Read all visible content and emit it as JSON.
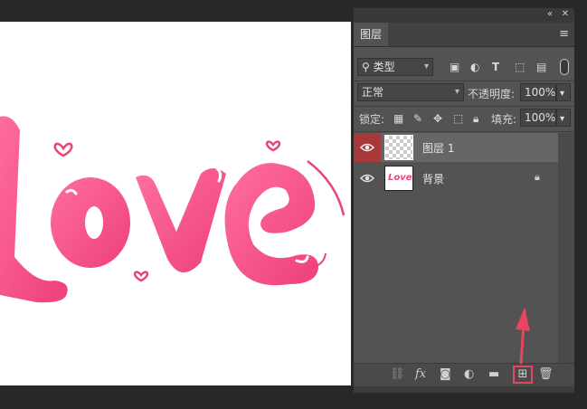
{
  "panel": {
    "tab_title": "图层",
    "filter": {
      "label": "类型"
    },
    "blend_mode": {
      "value": "正常"
    },
    "opacity": {
      "label": "不透明度:",
      "value": "100%"
    },
    "lock": {
      "label": "锁定:"
    },
    "fill": {
      "label": "填充:",
      "value": "100%"
    },
    "layers": [
      {
        "name": "图层 1",
        "visible": true,
        "selected": true,
        "thumb": "transparent"
      },
      {
        "name": "背景",
        "visible": true,
        "selected": false,
        "thumb": "love",
        "locked": true
      }
    ],
    "bottom_icons": [
      "link-icon",
      "fx-icon",
      "mask-icon",
      "adjustment-icon",
      "folder-icon",
      "new-layer-icon",
      "trash-icon"
    ],
    "bottom_labels": {
      "fx": "fx"
    },
    "highlight_color": "#e8455f"
  },
  "canvas": {
    "artwork_text": "Love",
    "thumb_text": "Love"
  }
}
